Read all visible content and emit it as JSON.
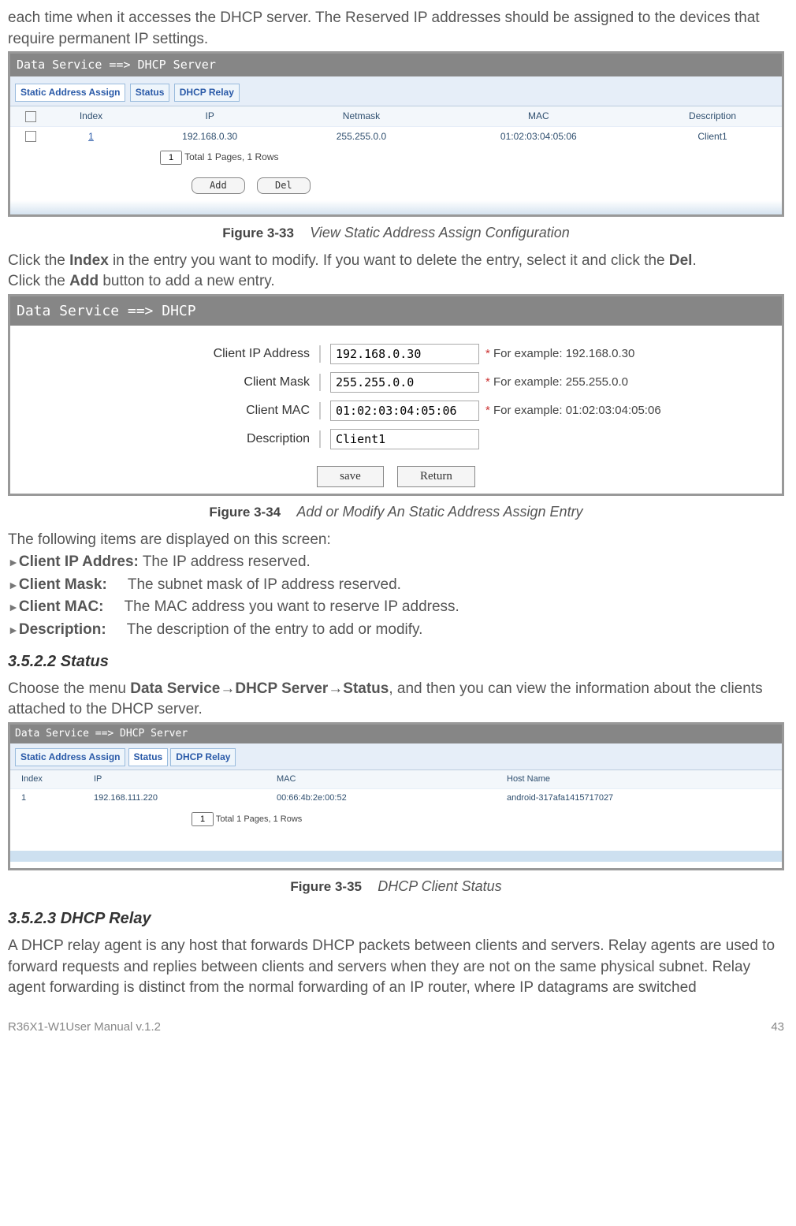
{
  "intro_text": "each time when it accesses the DHCP server. The Reserved IP addresses should be assigned to the devices that require permanent IP settings.",
  "fig33": {
    "panel_title": "Data Service ==> DHCP Server",
    "tabs": [
      "Static Address Assign",
      "Status",
      "DHCP Relay"
    ],
    "headers": [
      "",
      "Index",
      "IP",
      "Netmask",
      "MAC",
      "Description"
    ],
    "row": {
      "index": "1",
      "ip": "192.168.0.30",
      "netmask": "255.255.0.0",
      "mac": "01:02:03:04:05:06",
      "desc": "Client1"
    },
    "pager_page": "1",
    "pager_text": "Total 1 Pages, 1 Rows",
    "btn_add": "Add",
    "btn_del": "Del",
    "caption_label": "Figure 3-33",
    "caption_desc": "View Static Address Assign Configuration"
  },
  "para1_prefix": "Click the ",
  "para1_bold1": "Index",
  "para1_mid": " in the entry you want to modify. If you want to delete the entry, select it and click the ",
  "para1_bold2": "Del",
  "para1_suffix": ".",
  "para2_prefix": "Click the ",
  "para2_bold": "Add",
  "para2_suffix": " button to add a new entry.",
  "fig34": {
    "panel_title": "Data Service ==> DHCP",
    "rows": [
      {
        "label": "Client IP Address",
        "value": "192.168.0.30",
        "hint": "For example: 192.168.0.30"
      },
      {
        "label": "Client Mask",
        "value": "255.255.0.0",
        "hint": "For example: 255.255.0.0"
      },
      {
        "label": "Client MAC",
        "value": "01:02:03:04:05:06",
        "hint": "For example: 01:02:03:04:05:06"
      },
      {
        "label": "Description",
        "value": "Client1",
        "hint": ""
      }
    ],
    "btn_save": "save",
    "btn_return": "Return",
    "caption_label": "Figure 3-34",
    "caption_desc": "Add or Modify An Static Address Assign Entry"
  },
  "items_intro": "The following items are displayed on this screen:",
  "defs": [
    {
      "term": "Client IP Addres:",
      "desc": " The IP address reserved."
    },
    {
      "term": "Client Mask:",
      "desc": "     The subnet mask of IP address reserved."
    },
    {
      "term": "Client MAC:",
      "desc": "     The MAC address you want to reserve IP address."
    },
    {
      "term": "Description:",
      "desc": "     The description of the entry to add or modify."
    }
  ],
  "sec_status_heading": "3.5.2.2  Status",
  "status_text_pre": "Choose the menu ",
  "status_path1": "Data Service",
  "status_arrow": "→",
  "status_path2": "DHCP Server",
  "status_path3": "Status",
  "status_text_post": ", and then you can view the information about the clients attached to the DHCP server.",
  "fig35": {
    "panel_title": "Data Service ==> DHCP Server",
    "tabs": [
      "Static Address Assign",
      "Status",
      "DHCP Relay"
    ],
    "headers": [
      "Index",
      "IP",
      "MAC",
      "Host Name"
    ],
    "row": {
      "index": "1",
      "ip": "192.168.111.220",
      "mac": "00:66:4b:2e:00:52",
      "host": "android-317afa1415717027"
    },
    "pager_page": "1",
    "pager_text": "Total 1 Pages, 1 Rows",
    "caption_label": "Figure 3-35",
    "caption_desc": "DHCP Client Status"
  },
  "sec_relay_heading": "3.5.2.3  DHCP Relay",
  "relay_text": "A DHCP relay agent is any host that forwards DHCP packets between clients and servers. Relay agents are used to forward requests and replies between clients and servers when they are not on the same physical subnet. Relay agent forwarding is distinct from the normal forwarding of an IP router, where IP datagrams are switched",
  "footer_left": "R36X1-W1User Manual v.1.2",
  "footer_right": "43"
}
